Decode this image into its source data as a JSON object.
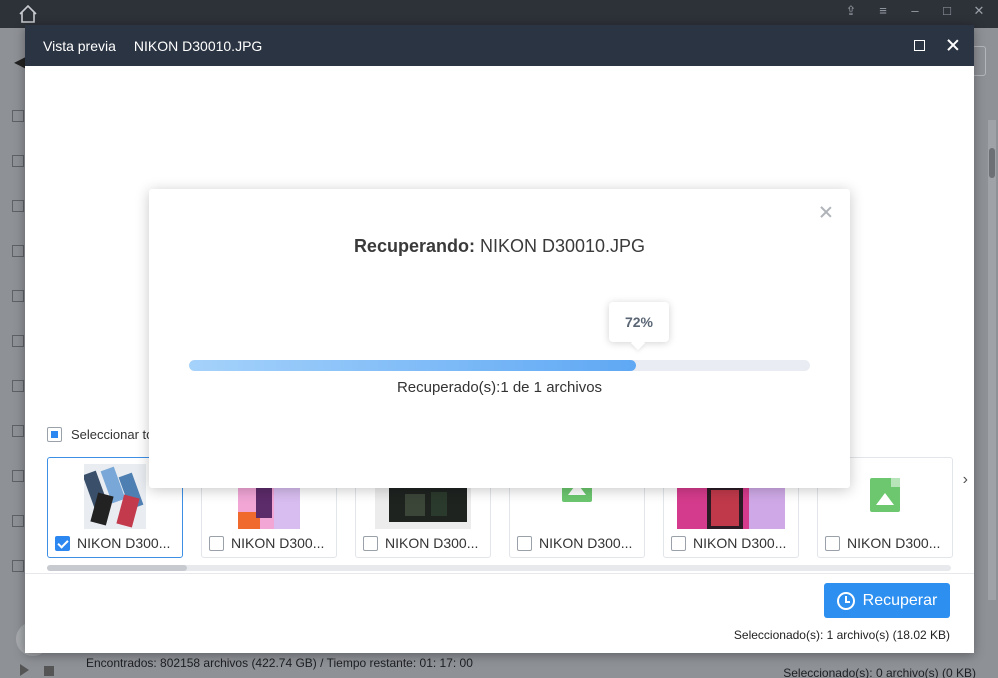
{
  "background": {
    "status_found": "Encontrados: 802158 archivos (422.74 GB) / Tiempo restante: 01: 17: 00",
    "status_selected": "Seleccionado(s): 0 archivo(s) (0 KB)"
  },
  "preview": {
    "title": "Vista previa",
    "filename": "NIKON D30010.JPG",
    "select_all_label": "Seleccionar to",
    "thumbnails": [
      {
        "label": "NIKON D300...",
        "checked": true,
        "icon": "phone-photo"
      },
      {
        "label": "NIKON D300...",
        "checked": false,
        "icon": "phone-photo"
      },
      {
        "label": "NIKON D300...",
        "checked": false,
        "icon": "dark-photo"
      },
      {
        "label": "NIKON D300...",
        "checked": false,
        "icon": "image-file-icon"
      },
      {
        "label": "NIKON D300...",
        "checked": false,
        "icon": "phone-photo"
      },
      {
        "label": "NIKON D300...",
        "checked": false,
        "icon": "image-file-icon"
      }
    ],
    "recover_button": "Recuperar",
    "selected_info": "Seleccionado(s): 1 archivo(s) (18.02 KB)"
  },
  "modal": {
    "title_label": "Recuperando:",
    "title_file": " NIKON D30010.JPG",
    "percent_text": "72%",
    "progress_fraction": 0.72,
    "progress_text": "Recuperado(s):1 de 1 archivos"
  },
  "colors": {
    "accent": "#2d8ff0",
    "header_bg": "#2b3442"
  }
}
